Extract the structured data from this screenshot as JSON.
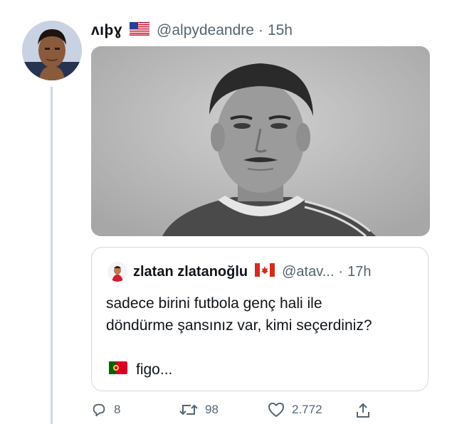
{
  "tweet": {
    "display_name": "ʌıþɣ",
    "flag_icon": "us-flag-icon",
    "handle": "@alpydeandre",
    "separator": "·",
    "time": "15h"
  },
  "quote": {
    "display_name": "zlatan zlatanoğlu",
    "flag_icon": "canada-flag-icon",
    "handle": "@atav...",
    "separator": "·",
    "time": "17h",
    "text_line1": "sadece birini futbola genç hali ile",
    "text_line2": "döndürme şansınız var, kimi seçerdiniz?",
    "footer_flag_icon": "portugal-flag-icon",
    "footer_text": "figo..."
  },
  "actions": {
    "reply_count": "8",
    "retweet_count": "98",
    "like_count": "2.772"
  },
  "colors": {
    "text": "#0f1419",
    "secondary": "#536471",
    "border": "#cfd9de"
  }
}
